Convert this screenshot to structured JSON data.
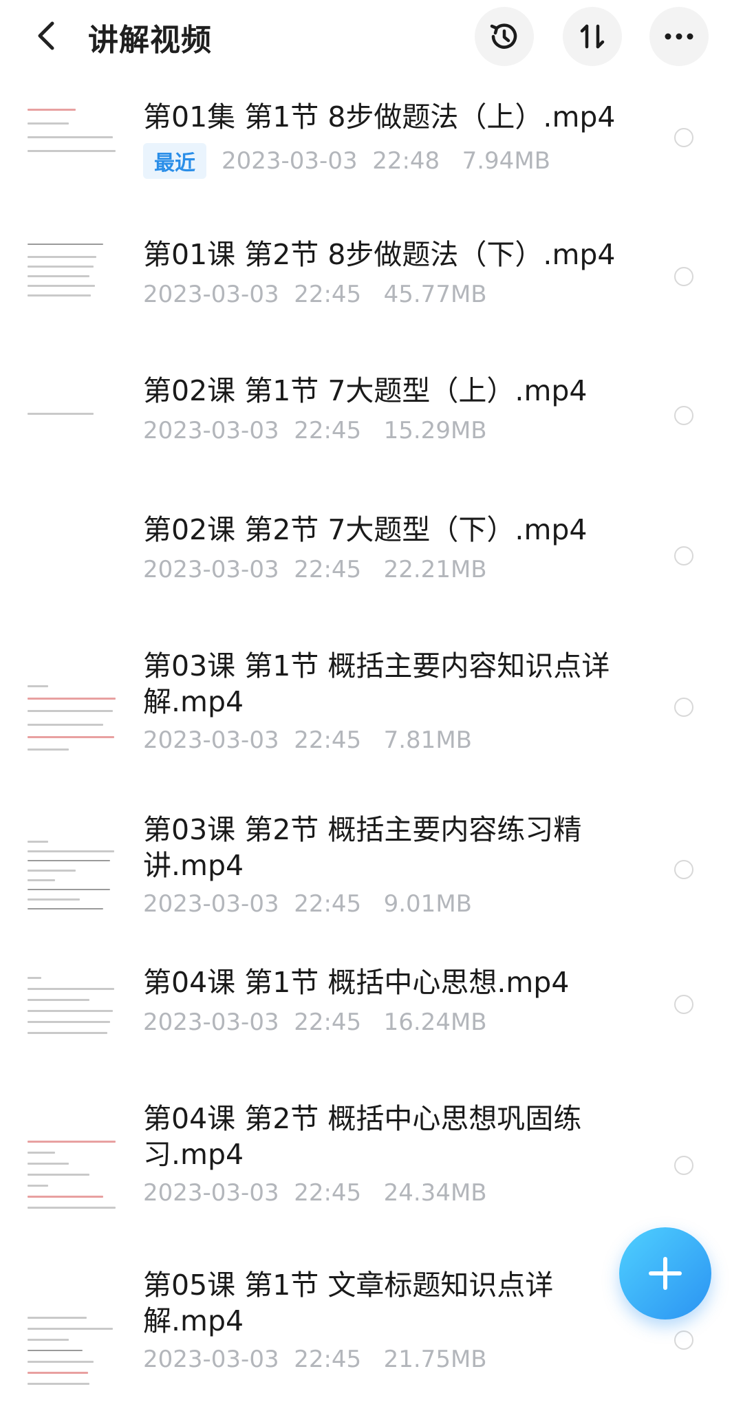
{
  "header": {
    "title": "讲解视频",
    "icons": [
      "back-icon",
      "history-icon",
      "sort-icon",
      "more-icon"
    ]
  },
  "files": [
    {
      "name": "第01集 第1节 8步做题法（上）.mp4",
      "badge": "最近",
      "meta": "2023-03-03  22:48   7.94MB"
    },
    {
      "name": "第01课 第2节 8步做题法（下）.mp4",
      "meta": "2023-03-03  22:45   45.77MB"
    },
    {
      "name": "第02课 第1节 7大题型（上）.mp4",
      "meta": "2023-03-03  22:45   15.29MB"
    },
    {
      "name": "第02课 第2节 7大题型（下）.mp4",
      "meta": "2023-03-03  22:45   22.21MB"
    },
    {
      "name": "第03课 第1节 概括主要内容知识点详解.mp4",
      "meta": "2023-03-03  22:45   7.81MB"
    },
    {
      "name": "第03课 第2节 概括主要内容练习精讲.mp4",
      "meta": "2023-03-03  22:45   9.01MB"
    },
    {
      "name": "第04课 第1节 概括中心思想.mp4",
      "meta": "2023-03-03  22:45   16.24MB"
    },
    {
      "name": "第04课 第2节 概括中心思想巩固练习.mp4",
      "meta": "2023-03-03  22:45   24.34MB"
    },
    {
      "name": "第05课 第1节 文章标题知识点详解.mp4",
      "meta": "2023-03-03  22:45   21.75MB"
    }
  ],
  "colors": {
    "accent": "#2a8ee8",
    "badge_bg": "#eaf4fd",
    "meta_text": "#b3b6bb",
    "fab_start": "#4fd0ff",
    "fab_end": "#2b93f2"
  },
  "fab": {
    "icon": "plus-icon"
  }
}
